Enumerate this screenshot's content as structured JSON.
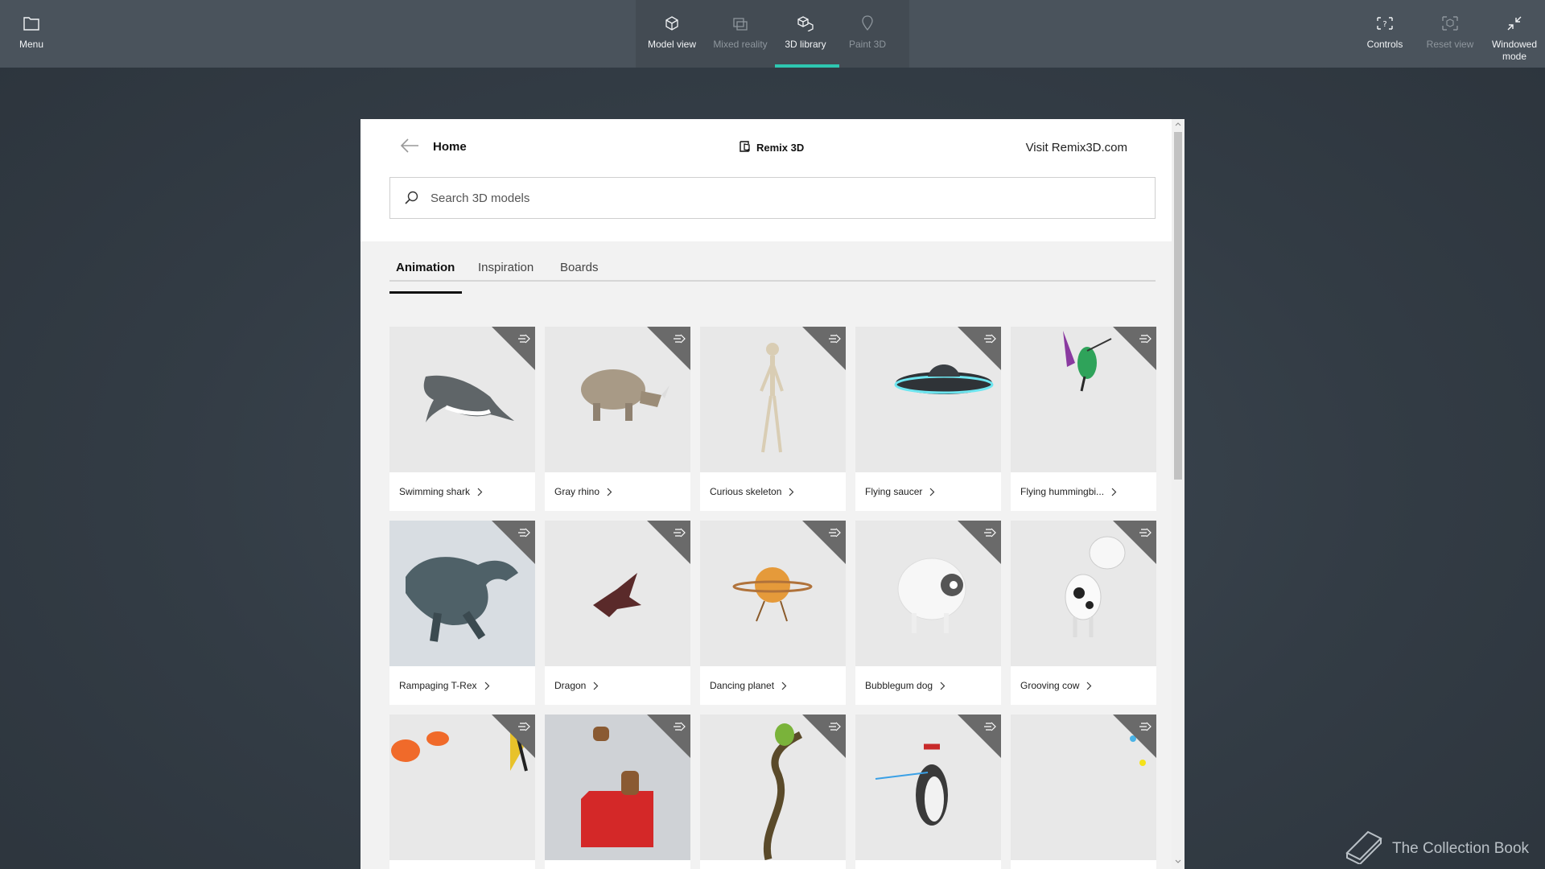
{
  "topbar": {
    "menu_label": "Menu",
    "center": [
      {
        "label": "Model view",
        "icon": "cube-icon",
        "enabled": true
      },
      {
        "label": "Mixed reality",
        "icon": "mixed-reality-icon",
        "enabled": false
      },
      {
        "label": "3D library",
        "icon": "library-icon",
        "enabled": true,
        "active": true
      },
      {
        "label": "Paint 3D",
        "icon": "paint-icon",
        "enabled": false
      }
    ],
    "controls_label": "Controls",
    "reset_label": "Reset view",
    "windowed_line1": "Windowed",
    "windowed_line2": "mode",
    "accent": "#2ec7b1"
  },
  "panel": {
    "home_title": "Home",
    "brand": "Remix 3D",
    "visit_link": "Visit Remix3D.com",
    "search_placeholder": "Search 3D models",
    "tabs": [
      "Animation",
      "Inspiration",
      "Boards"
    ],
    "active_tab": "Animation",
    "models": [
      {
        "label": "Swimming shark"
      },
      {
        "label": "Gray rhino"
      },
      {
        "label": "Curious skeleton"
      },
      {
        "label": "Flying saucer"
      },
      {
        "label": "Flying hummingbi..."
      },
      {
        "label": "Rampaging T-Rex"
      },
      {
        "label": "Dragon"
      },
      {
        "label": "Dancing planet"
      },
      {
        "label": "Bubblegum dog"
      },
      {
        "label": "Grooving cow"
      },
      {
        "label": ""
      },
      {
        "label": ""
      },
      {
        "label": ""
      },
      {
        "label": ""
      },
      {
        "label": ""
      }
    ]
  },
  "watermark": "The Collection Book"
}
